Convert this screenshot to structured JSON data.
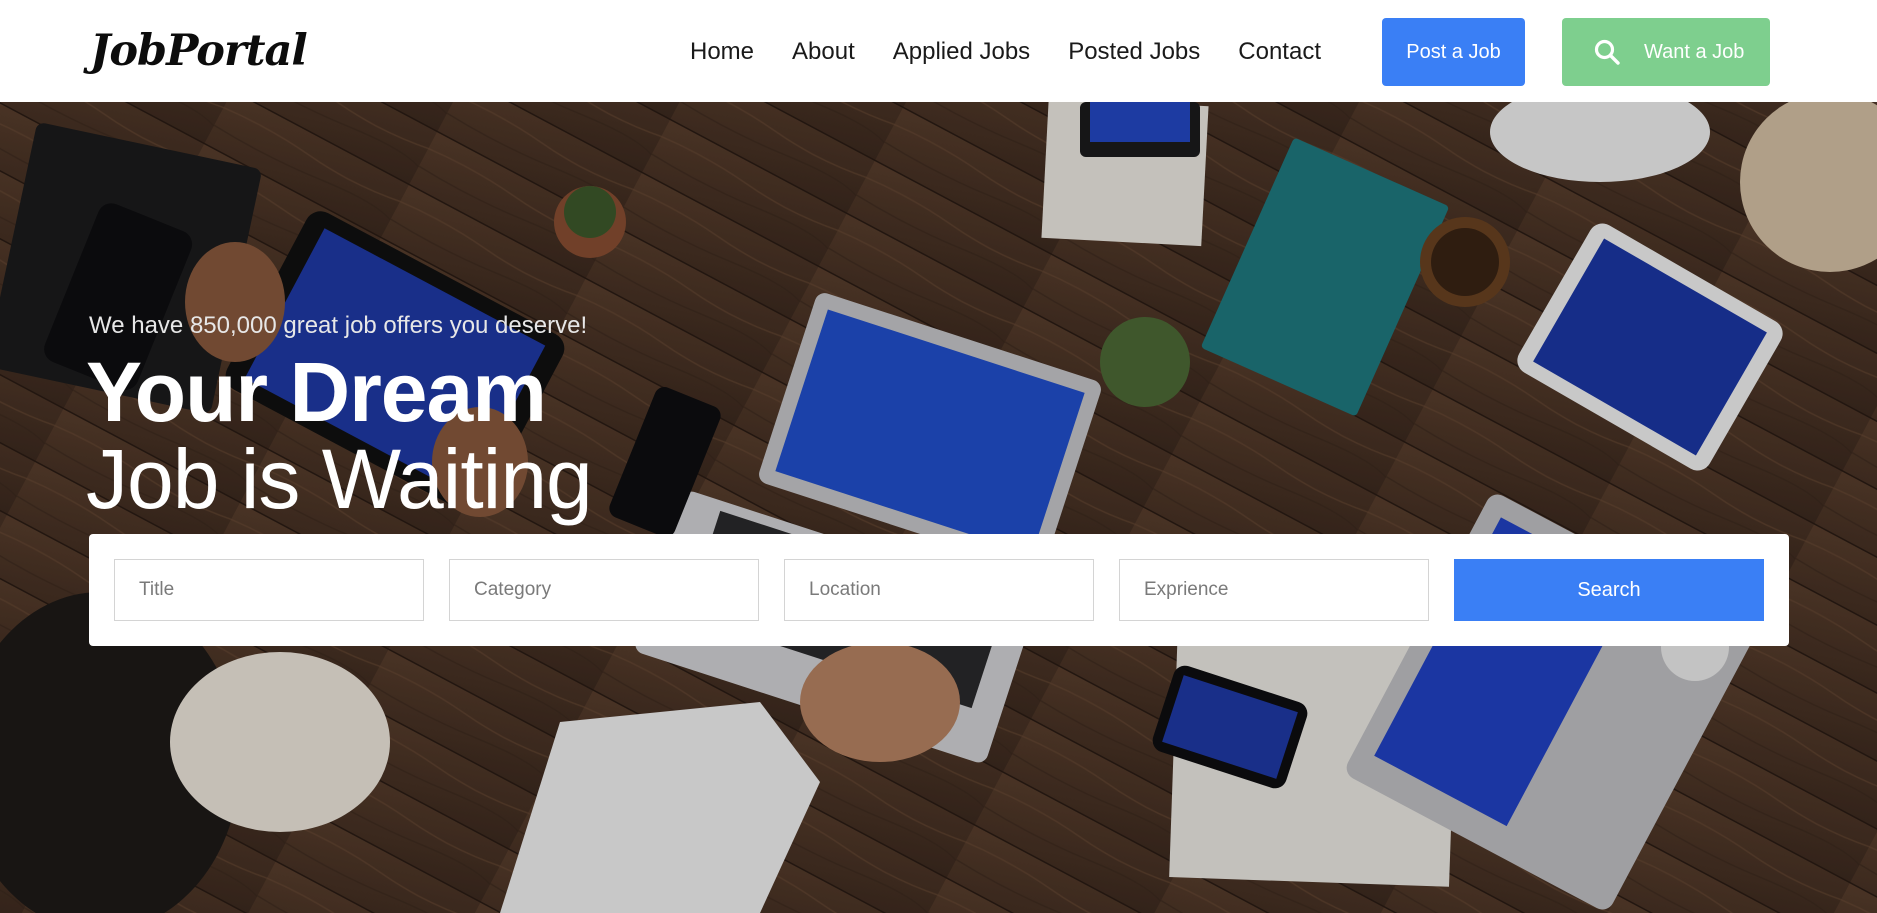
{
  "brand": {
    "logo_text": "JobPortal"
  },
  "nav": {
    "items": [
      {
        "label": "Home"
      },
      {
        "label": "About"
      },
      {
        "label": "Applied Jobs"
      },
      {
        "label": "Posted Jobs"
      },
      {
        "label": "Contact"
      }
    ],
    "post_job_label": "Post a Job",
    "want_job_label": "Want a Job",
    "want_job_icon": "search-icon"
  },
  "hero": {
    "tagline": "We have 850,000 great job offers you deserve!",
    "headline_bold": "Your Dream",
    "headline_light": "Job is Waiting"
  },
  "search": {
    "title_placeholder": "Title",
    "category_placeholder": "Category",
    "location_placeholder": "Location",
    "experience_placeholder": "Exprience",
    "button_label": "Search"
  },
  "colors": {
    "primary": "#3a7ff5",
    "secondary": "#7ecf8e",
    "text": "#1a1a1a"
  }
}
